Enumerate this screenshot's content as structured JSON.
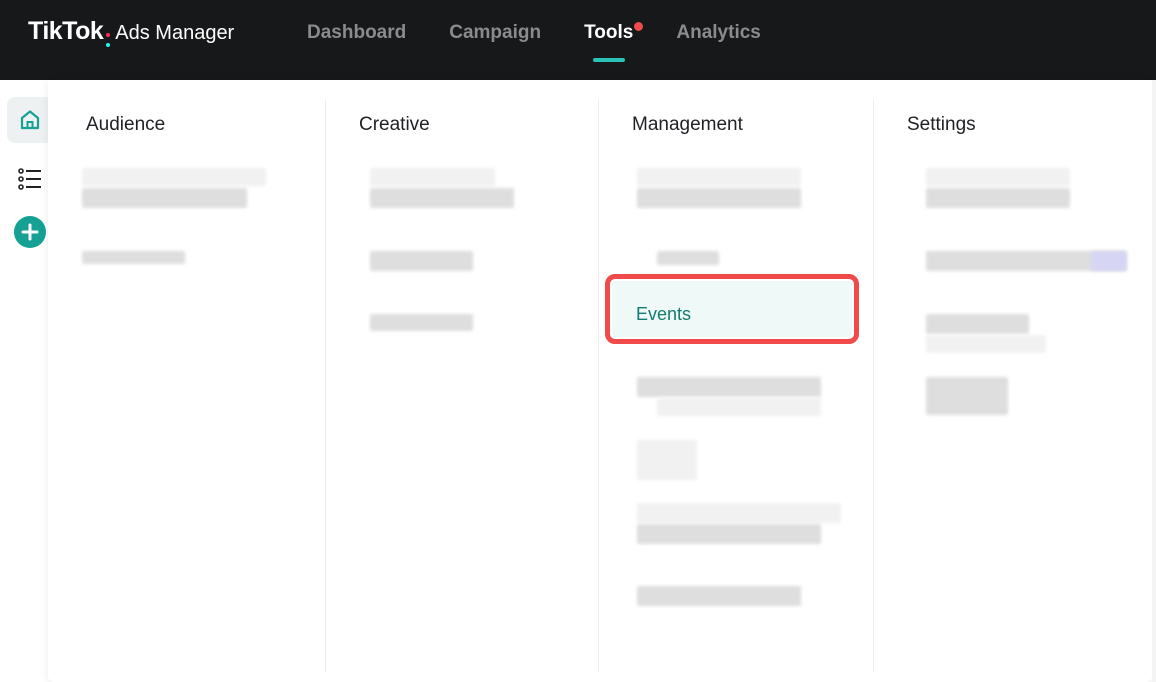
{
  "header": {
    "brand": "TikTok",
    "product": "Ads Manager",
    "colon_colors": [
      "#fe2c55",
      "#25f4ee"
    ],
    "nav": [
      {
        "label": "Dashboard",
        "active": false
      },
      {
        "label": "Campaign",
        "active": false
      },
      {
        "label": "Tools",
        "active": true,
        "notification_dot": true
      },
      {
        "label": "Analytics",
        "active": false
      }
    ]
  },
  "sidebar": {
    "items": [
      {
        "icon": "home-icon",
        "active": true
      },
      {
        "icon": "list-icon",
        "active": false
      },
      {
        "icon": "add-icon",
        "active": false
      }
    ]
  },
  "tools_menu": {
    "columns": [
      {
        "title": "Audience"
      },
      {
        "title": "Creative"
      },
      {
        "title": "Management",
        "highlighted_item": "Events"
      },
      {
        "title": "Settings"
      }
    ]
  },
  "colors": {
    "accent": "#2bc3b7",
    "highlight_border": "#f04a4a",
    "events_text": "#127a70",
    "topbar": "#17181a"
  }
}
